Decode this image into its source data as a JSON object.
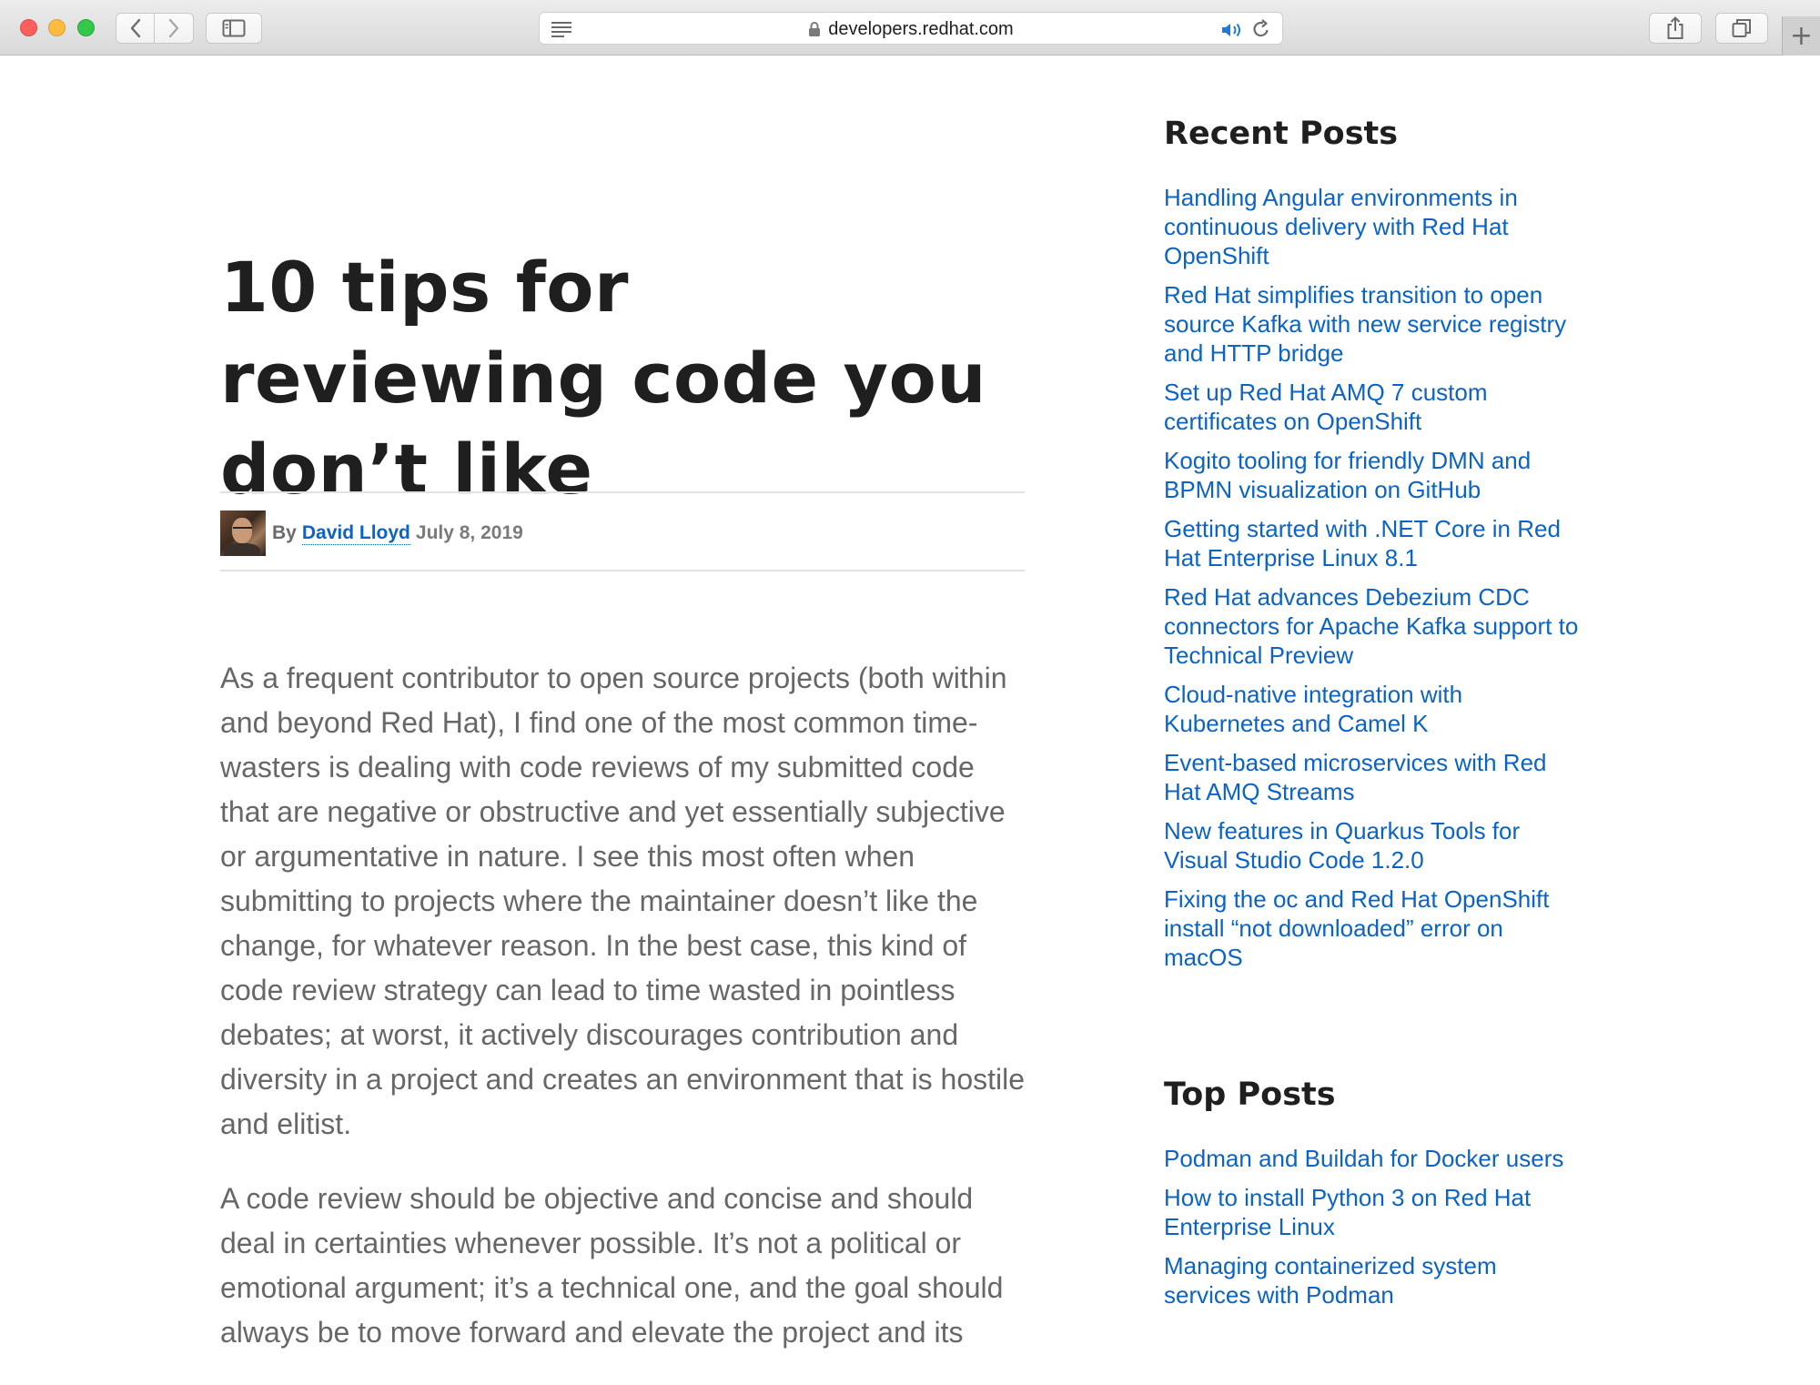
{
  "browser": {
    "url": "developers.redhat.com",
    "new_tab_label": "+"
  },
  "article": {
    "title": "10 tips for reviewing code you don’t like",
    "byline": {
      "by": "By",
      "author": "David Lloyd",
      "date": "July 8, 2019"
    },
    "paragraphs": [
      "As a frequent contributor to open source projects (both within and beyond Red Hat), I find one of the most common time-wasters is dealing with code reviews of my submitted code that are negative or obstructive and yet essentially subjective or argumentative in nature. I see this most often when submitting to projects where the maintainer doesn’t like the change, for whatever reason. In the best case, this kind of code review strategy can lead to time wasted in pointless debates; at worst, it actively discourages contribution and diversity in a project and creates an environment that is hostile and elitist.",
      "A code review should be objective and concise and should deal in certainties whenever possible. It’s not a political or emotional argument; it’s a technical one, and the goal should always be to move forward and elevate the project and its"
    ]
  },
  "sidebar": {
    "recent_title": "Recent Posts",
    "recent_posts": [
      "Handling Angular environments in continuous delivery with Red Hat OpenShift",
      "Red Hat simplifies transition to open source Kafka with new service registry and HTTP bridge",
      "Set up Red Hat AMQ 7 custom certificates on OpenShift",
      "Kogito tooling for friendly DMN and BPMN visualization on GitHub",
      "Getting started with .NET Core in Red Hat Enterprise Linux 8.1",
      "Red Hat advances Debezium CDC connectors for Apache Kafka support to Technical Preview",
      "Cloud-native integration with Kubernetes and Camel K",
      "Event-based microservices with Red Hat AMQ Streams",
      "New features in Quarkus Tools for Visual Studio Code 1.2.0",
      "Fixing the oc and Red Hat OpenShift install “not downloaded” error on macOS"
    ],
    "top_title": "Top Posts",
    "top_posts": [
      "Podman and Buildah for Docker users",
      "How to install Python 3 on Red Hat Enterprise Linux",
      "Managing containerized system services with Podman"
    ]
  },
  "colors": {
    "link": "#0b63c5",
    "heading": "#1f1f1f",
    "body_text": "#676767"
  }
}
